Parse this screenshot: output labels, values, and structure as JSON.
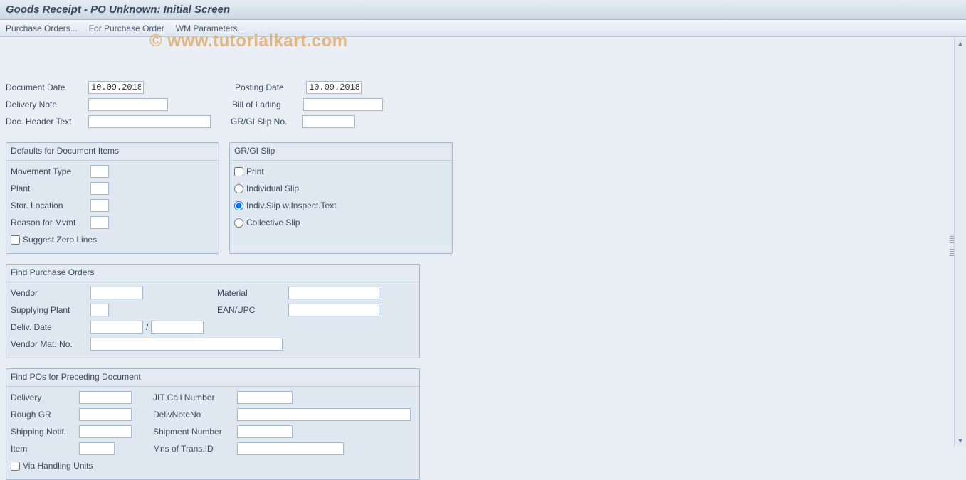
{
  "titlebar": "Goods Receipt - PO Unknown: Initial Screen",
  "menu": {
    "purchase_orders": "Purchase Orders...",
    "for_po": "For Purchase Order",
    "wm_params": "WM Parameters..."
  },
  "watermark": "© www.tutorialkart.com",
  "header": {
    "doc_date_lbl": "Document Date",
    "doc_date_val": "10.09.2018",
    "posting_date_lbl": "Posting Date",
    "posting_date_val": "10.09.2018",
    "deliv_note_lbl": "Delivery Note",
    "deliv_note_val": "",
    "bill_lading_lbl": "Bill of Lading",
    "bill_lading_val": "",
    "doc_hdr_lbl": "Doc. Header Text",
    "doc_hdr_val": "",
    "grgi_slip_no_lbl": "GR/GI Slip No.",
    "grgi_slip_no_val": ""
  },
  "defaults": {
    "title": "Defaults for Document Items",
    "mvt_lbl": "Movement Type",
    "mvt_val": "",
    "plant_lbl": "Plant",
    "plant_val": "",
    "sloc_lbl": "Stor. Location",
    "sloc_val": "",
    "reason_lbl": "Reason for Mvmt",
    "reason_val": "",
    "suggest_lbl": "Suggest Zero Lines",
    "suggest_checked": false
  },
  "slip": {
    "title": "GR/GI Slip",
    "print_lbl": "Print",
    "print_checked": false,
    "individual_lbl": "Individual Slip",
    "inspect_lbl": "Indiv.Slip w.Inspect.Text",
    "collective_lbl": "Collective Slip",
    "selected": "inspect"
  },
  "find": {
    "title": "Find Purchase Orders",
    "vendor_lbl": "Vendor",
    "vendor_val": "",
    "material_lbl": "Material",
    "material_val": "",
    "supp_plant_lbl": "Supplying Plant",
    "supp_plant_val": "",
    "ean_lbl": "EAN/UPC",
    "ean_val": "",
    "deliv_date_lbl": "Deliv. Date",
    "deliv_date_from": "",
    "deliv_date_to": "",
    "vendor_mat_lbl": "Vendor Mat. No.",
    "vendor_mat_val": ""
  },
  "findpo": {
    "title": "Find POs for Preceding Document",
    "delivery_lbl": "Delivery",
    "delivery_val": "",
    "jit_lbl": "JIT Call Number",
    "jit_val": "",
    "rough_lbl": "Rough GR",
    "rough_val": "",
    "dnn_lbl": "DelivNoteNo",
    "dnn_val": "",
    "ship_not_lbl": "Shipping Notif.",
    "ship_not_val": "",
    "ship_num_lbl": "Shipment Number",
    "ship_num_val": "",
    "item_lbl": "Item",
    "item_val": "",
    "mns_lbl": "Mns of Trans.ID",
    "mns_val": "",
    "via_hu_lbl": "Via Handling Units",
    "via_hu_checked": false
  }
}
